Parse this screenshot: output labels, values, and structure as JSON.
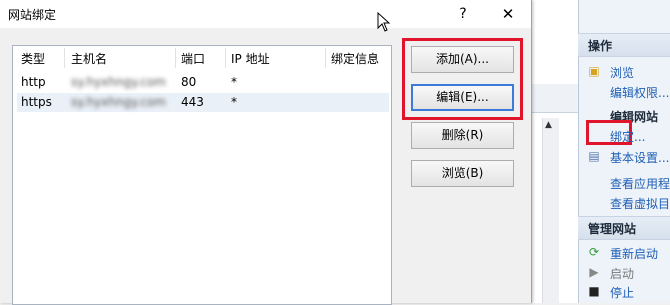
{
  "dialog": {
    "title": "网站绑定",
    "help_symbol": "?",
    "close_symbol": "✕",
    "columns": [
      "类型",
      "主机名",
      "端口",
      "IP 地址",
      "绑定信息"
    ],
    "rows": [
      {
        "type": "http",
        "host": "sy.hyxhngy.com",
        "port": "80",
        "ip": "*",
        "info": ""
      },
      {
        "type": "https",
        "host": "sy.hyxhngy.com",
        "port": "443",
        "ip": "*",
        "info": ""
      }
    ],
    "buttons": {
      "add": "添加(A)...",
      "edit": "编辑(E)...",
      "remove": "删除(R)",
      "browse": "浏览(B)"
    }
  },
  "actions_pane": {
    "header": "操作",
    "browse": "浏览",
    "edit_permissions": "编辑权限...",
    "edit_site_header": "编辑网站",
    "bindings": "绑定...",
    "basic_settings": "基本设置...",
    "view_apps": "查看应用程",
    "view_vdirs": "查看虚拟目",
    "manage_site_header": "管理网站",
    "restart": "重新启动",
    "start": "启动",
    "stop": "停止"
  },
  "colors": {
    "highlight_red": "#e0142a",
    "link_blue": "#1f5fb4",
    "focus_blue": "#3d7bd9"
  }
}
